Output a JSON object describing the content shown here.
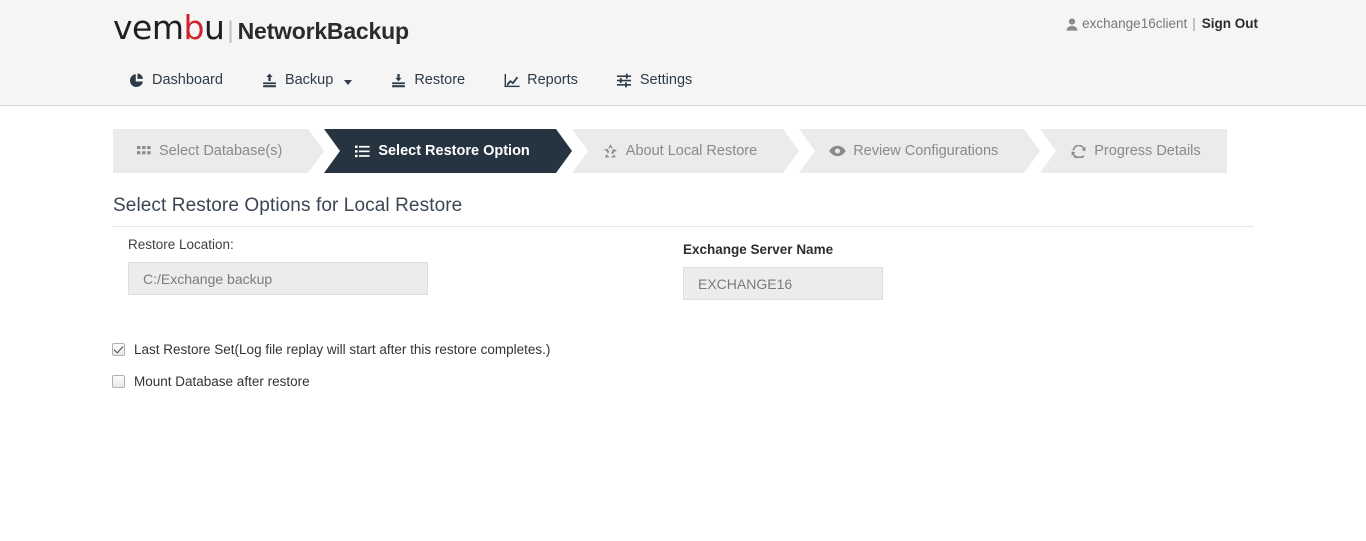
{
  "header": {
    "brand": {
      "logo_prefix": "vem",
      "logo_accent": "b",
      "logo_suffix": "u",
      "separator": "|",
      "product": "NetworkBackup"
    },
    "account": {
      "icon": "user-icon",
      "username": "exchange16client",
      "separator": "|",
      "signout_label": "Sign Out"
    },
    "nav": [
      {
        "label": "Dashboard",
        "icon": "pie-chart-icon",
        "has_caret": false
      },
      {
        "label": "Backup",
        "icon": "upload-icon",
        "has_caret": true
      },
      {
        "label": "Restore",
        "icon": "download-icon",
        "has_caret": false
      },
      {
        "label": "Reports",
        "icon": "chart-line-icon",
        "has_caret": false
      },
      {
        "label": "Settings",
        "icon": "sliders-icon",
        "has_caret": false
      }
    ]
  },
  "wizard": {
    "steps": [
      {
        "label": "Select Database(s)",
        "icon": "grid-icon",
        "active": false
      },
      {
        "label": "Select Restore Option",
        "icon": "list-icon",
        "active": true
      },
      {
        "label": "About Local Restore",
        "icon": "recycle-icon",
        "active": false
      },
      {
        "label": "Review Configurations",
        "icon": "eye-icon",
        "active": false
      },
      {
        "label": "Progress Details",
        "icon": "refresh-icon",
        "active": false
      }
    ]
  },
  "main": {
    "page_title": "Select Restore Options for Local Restore",
    "restore_location": {
      "label": "Restore Location:",
      "value": "C:/Exchange backup"
    },
    "exchange_server": {
      "label": "Exchange Server Name",
      "value": "EXCHANGE16"
    },
    "options": [
      {
        "label": "Last Restore Set(Log file replay will start after this restore completes.)",
        "checked": true
      },
      {
        "label": "Mount Database after restore",
        "checked": false
      }
    ]
  },
  "colors": {
    "header_bg": "#f5f5f5",
    "step_active_bg": "#263340",
    "step_inactive_bg": "#ebebeb",
    "brand_accent": "#d0222c",
    "input_bg": "#ececec",
    "text_dark": "#333333"
  }
}
